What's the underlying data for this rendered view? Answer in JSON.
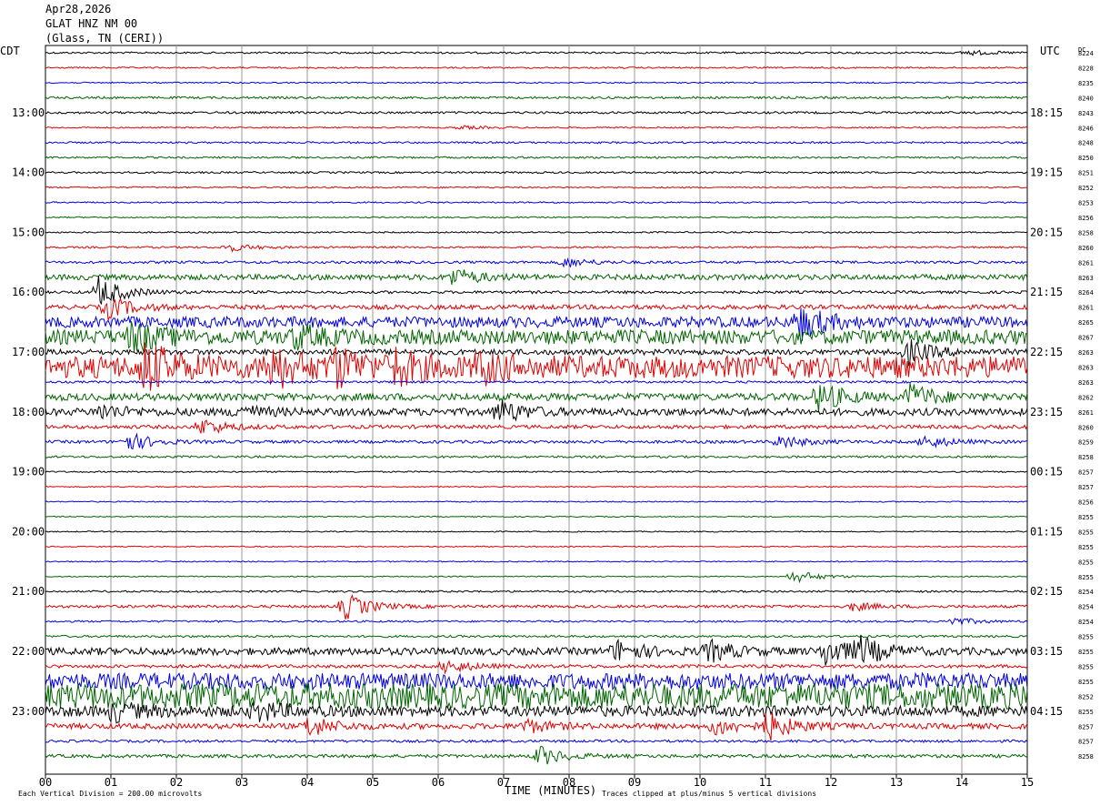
{
  "header": {
    "date": "Apr28,2026",
    "station": "GLAT HNZ NM 00",
    "location": "(Glass, TN (CERI))",
    "left_tz": "CDT",
    "right_tz": "UTC",
    "dc_label": "DC"
  },
  "footer": {
    "scale_note": "Each Vertical Division = 200.00 microvolts",
    "xlabel": "TIME (MINUTES)",
    "clip_note": "Traces clipped at plus/minus 5 vertical divisions"
  },
  "chart_data": {
    "type": "line",
    "title": "GLAT HNZ NM 00",
    "xlabel": "TIME (MINUTES)",
    "x_ticks": [
      "00",
      "01",
      "02",
      "03",
      "04",
      "05",
      "06",
      "07",
      "08",
      "09",
      "10",
      "11",
      "12",
      "13",
      "14",
      "15"
    ],
    "xlim": [
      0,
      15
    ],
    "grid": true,
    "trace_colors": [
      "#000000",
      "#e00000",
      "#0000e0",
      "#006400"
    ],
    "left_hour_labels": [
      "13:00",
      "14:00",
      "15:00",
      "16:00",
      "17:00",
      "18:00",
      "19:00",
      "20:00",
      "21:00",
      "22:00",
      "23:00"
    ],
    "right_hour_labels": [
      "18:15",
      "19:15",
      "20:15",
      "21:15",
      "22:15",
      "23:15",
      "00:15",
      "01:15",
      "02:15",
      "03:15",
      "04:15"
    ],
    "row_dc_values": [
      "8224",
      "8228",
      "8235",
      "8240",
      "8243",
      "8246",
      "8248",
      "8250",
      "8251",
      "8252",
      "8253",
      "8256",
      "8258",
      "8260",
      "8261",
      "8263",
      "8264",
      "8261",
      "8265",
      "8267",
      "8263",
      "8263",
      "8263",
      "8262",
      "8261",
      "8260",
      "8259",
      "8258",
      "8257",
      "8257",
      "8256",
      "8255",
      "8255",
      "8255",
      "8255",
      "8255",
      "8254",
      "8254",
      "8254",
      "8255",
      "8255",
      "8255",
      "8255",
      "8252",
      "8255",
      "8257",
      "8257",
      "8258"
    ],
    "noise_levels": [
      1,
      0.8,
      0.7,
      1.2,
      1.2,
      0.8,
      1,
      1,
      1,
      0.8,
      0.8,
      0.7,
      0.8,
      1,
      1.4,
      3,
      1.5,
      2.5,
      6,
      8,
      3,
      12,
      1.2,
      4,
      4,
      2,
      1.6,
      1.2,
      0.8,
      0.6,
      0.6,
      0.6,
      0.6,
      0.6,
      0.6,
      0.6,
      1,
      1.5,
      1,
      1.2,
      4,
      1.8,
      9,
      14,
      6,
      3,
      1.4,
      1.8
    ],
    "events": [
      {
        "row": 0,
        "minute": 14.05,
        "amp": 3
      },
      {
        "row": 5,
        "minute": 6.3,
        "amp": 2
      },
      {
        "row": 13,
        "minute": 2.75,
        "amp": 5
      },
      {
        "row": 14,
        "minute": 7.9,
        "amp": 6
      },
      {
        "row": 15,
        "minute": 6.2,
        "amp": 10
      },
      {
        "row": 16,
        "minute": 0.8,
        "amp": 18
      },
      {
        "row": 17,
        "minute": 0.9,
        "amp": 14
      },
      {
        "row": 18,
        "minute": 11.5,
        "amp": 18
      },
      {
        "row": 19,
        "minute": 1.3,
        "amp": 16
      },
      {
        "row": 19,
        "minute": 3.8,
        "amp": 12
      },
      {
        "row": 20,
        "minute": 13.15,
        "amp": 14
      },
      {
        "row": 21,
        "minute": 1.5,
        "amp": 26
      },
      {
        "row": 21,
        "minute": 3.4,
        "amp": 22
      },
      {
        "row": 21,
        "minute": 4.4,
        "amp": 18
      },
      {
        "row": 21,
        "minute": 5.3,
        "amp": 16
      },
      {
        "row": 21,
        "minute": 6.6,
        "amp": 14
      },
      {
        "row": 23,
        "minute": 11.8,
        "amp": 16
      },
      {
        "row": 23,
        "minute": 13.2,
        "amp": 14
      },
      {
        "row": 24,
        "minute": 6.9,
        "amp": 14
      },
      {
        "row": 24,
        "minute": 0.8,
        "amp": 8
      },
      {
        "row": 24,
        "minute": 2.9,
        "amp": 8
      },
      {
        "row": 25,
        "minute": 2.35,
        "amp": 10
      },
      {
        "row": 26,
        "minute": 1.2,
        "amp": 12
      },
      {
        "row": 26,
        "minute": 11.2,
        "amp": 8
      },
      {
        "row": 26,
        "minute": 13.4,
        "amp": 8
      },
      {
        "row": 35,
        "minute": 11.4,
        "amp": 8
      },
      {
        "row": 37,
        "minute": 4.55,
        "amp": 16
      },
      {
        "row": 37,
        "minute": 12.3,
        "amp": 5
      },
      {
        "row": 38,
        "minute": 13.8,
        "amp": 5
      },
      {
        "row": 40,
        "minute": 11.9,
        "amp": 16
      },
      {
        "row": 40,
        "minute": 8.7,
        "amp": 12
      },
      {
        "row": 40,
        "minute": 12.4,
        "amp": 14
      },
      {
        "row": 40,
        "minute": 10.1,
        "amp": 12
      },
      {
        "row": 41,
        "minute": 6.1,
        "amp": 8
      },
      {
        "row": 44,
        "minute": 1.0,
        "amp": 10
      },
      {
        "row": 44,
        "minute": 3.2,
        "amp": 10
      },
      {
        "row": 45,
        "minute": 11.0,
        "amp": 16
      },
      {
        "row": 45,
        "minute": 4.0,
        "amp": 12
      },
      {
        "row": 45,
        "minute": 7.3,
        "amp": 8
      },
      {
        "row": 45,
        "minute": 10.2,
        "amp": 10
      },
      {
        "row": 47,
        "minute": 7.5,
        "amp": 12
      }
    ]
  }
}
